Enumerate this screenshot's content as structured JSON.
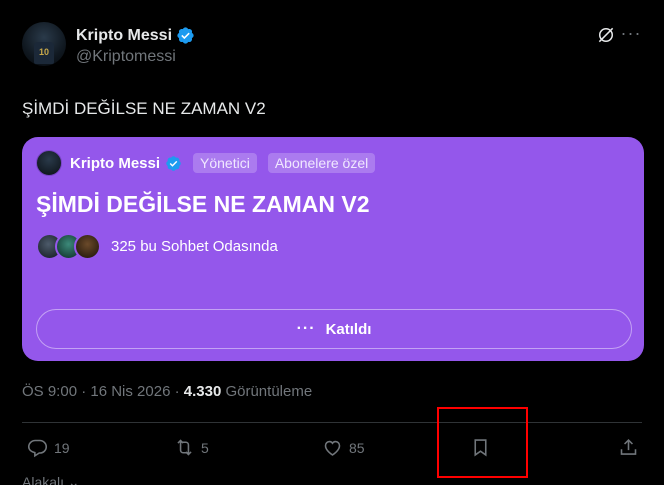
{
  "author": {
    "display_name": "Kripto Messi",
    "handle": "@Kriptomessi",
    "jersey_number": "10"
  },
  "tweet": {
    "text": "ŞİMDİ DEĞİLSE NE ZAMAN V2"
  },
  "space_card": {
    "host_name": "Kripto Messi",
    "badge_admin": "Yönetici",
    "badge_subscribers": "Abonelere özel",
    "title": "ŞİMDİ DEĞİLSE NE ZAMAN V2",
    "listeners_text": "325 bu Sohbet Odasında",
    "join_label": "Katıldı",
    "background_color": "#9457eb"
  },
  "meta": {
    "time_date": "ÖS 9:00 · 16 Nis 2026 · ",
    "views_count": "4.330",
    "views_label": " Görüntüleme"
  },
  "actions": {
    "replies": "19",
    "reposts": "5",
    "likes": "85"
  },
  "bottom": {
    "partial_text": "Alakalı ⌄"
  },
  "colors": {
    "verified": "#1d9bf0",
    "highlight": "#ff0000"
  },
  "icons": [
    "verified-icon",
    "grok-icon",
    "more-icon",
    "reply-icon",
    "repost-icon",
    "like-icon",
    "bookmark-icon",
    "share-icon"
  ]
}
